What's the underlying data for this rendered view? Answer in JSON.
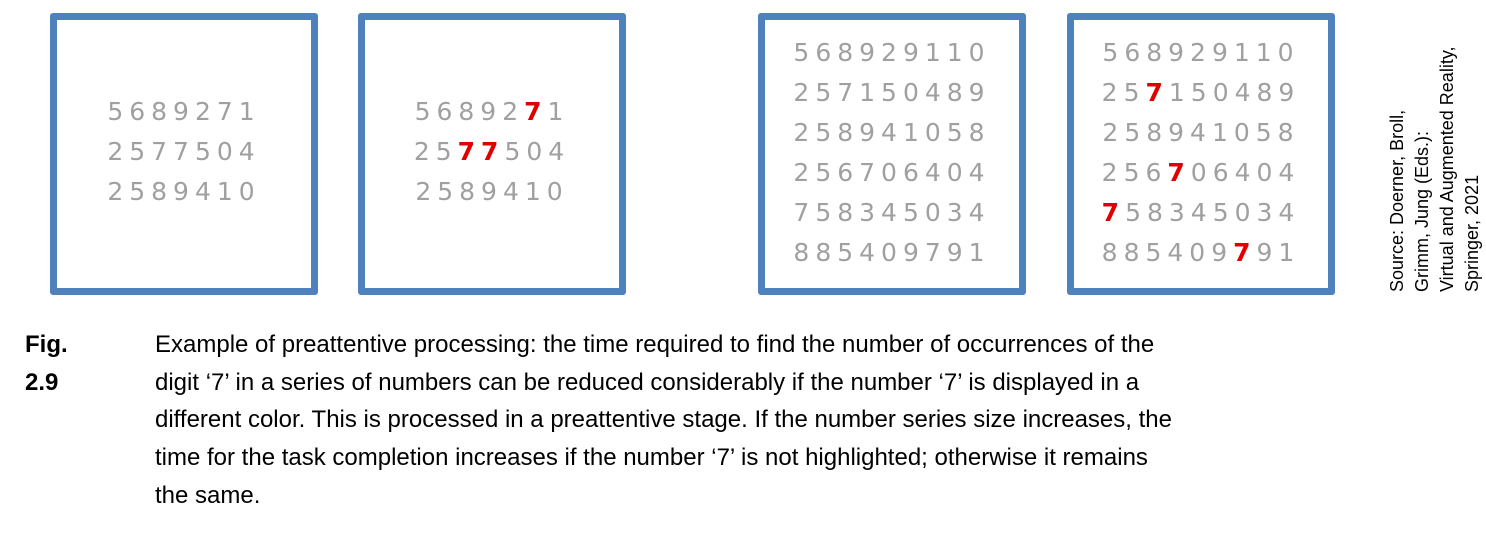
{
  "colors": {
    "frame": "#4f81bd",
    "digit": "#a0a0a0",
    "highlight": "#e00000"
  },
  "panels": [
    {
      "rows": [
        "5689271",
        "2577504",
        "2589410"
      ],
      "highlight": false
    },
    {
      "rows": [
        "5689271",
        "2577504",
        "2589410"
      ],
      "highlight": true
    },
    {
      "rows": [
        "568929110",
        "257150489",
        "258941058",
        "256706404",
        "758345034",
        "885409791"
      ],
      "highlight": false
    },
    {
      "rows": [
        "568929110",
        "257150489",
        "258941058",
        "256706404",
        "758345034",
        "885409791"
      ],
      "highlight": true
    }
  ],
  "source": {
    "lines": [
      "Source: Doerner, Broll,",
      "Grimm, Jung (Eds.):",
      "Virtual and Augmented Reality,",
      "Springer, 2021"
    ]
  },
  "caption": {
    "label": "Fig. 2.9",
    "lines": [
      "Example of preattentive processing: the time required to find the number of occurrences of the",
      "digit ‘7’ in a series of numbers can be reduced considerably if the number ‘7’ is displayed in a",
      "different color. This is processed in a preattentive stage. If the number series size increases, the",
      "time for the task completion increases if the number ‘7’ is not highlighted; otherwise it remains",
      "the same."
    ]
  }
}
